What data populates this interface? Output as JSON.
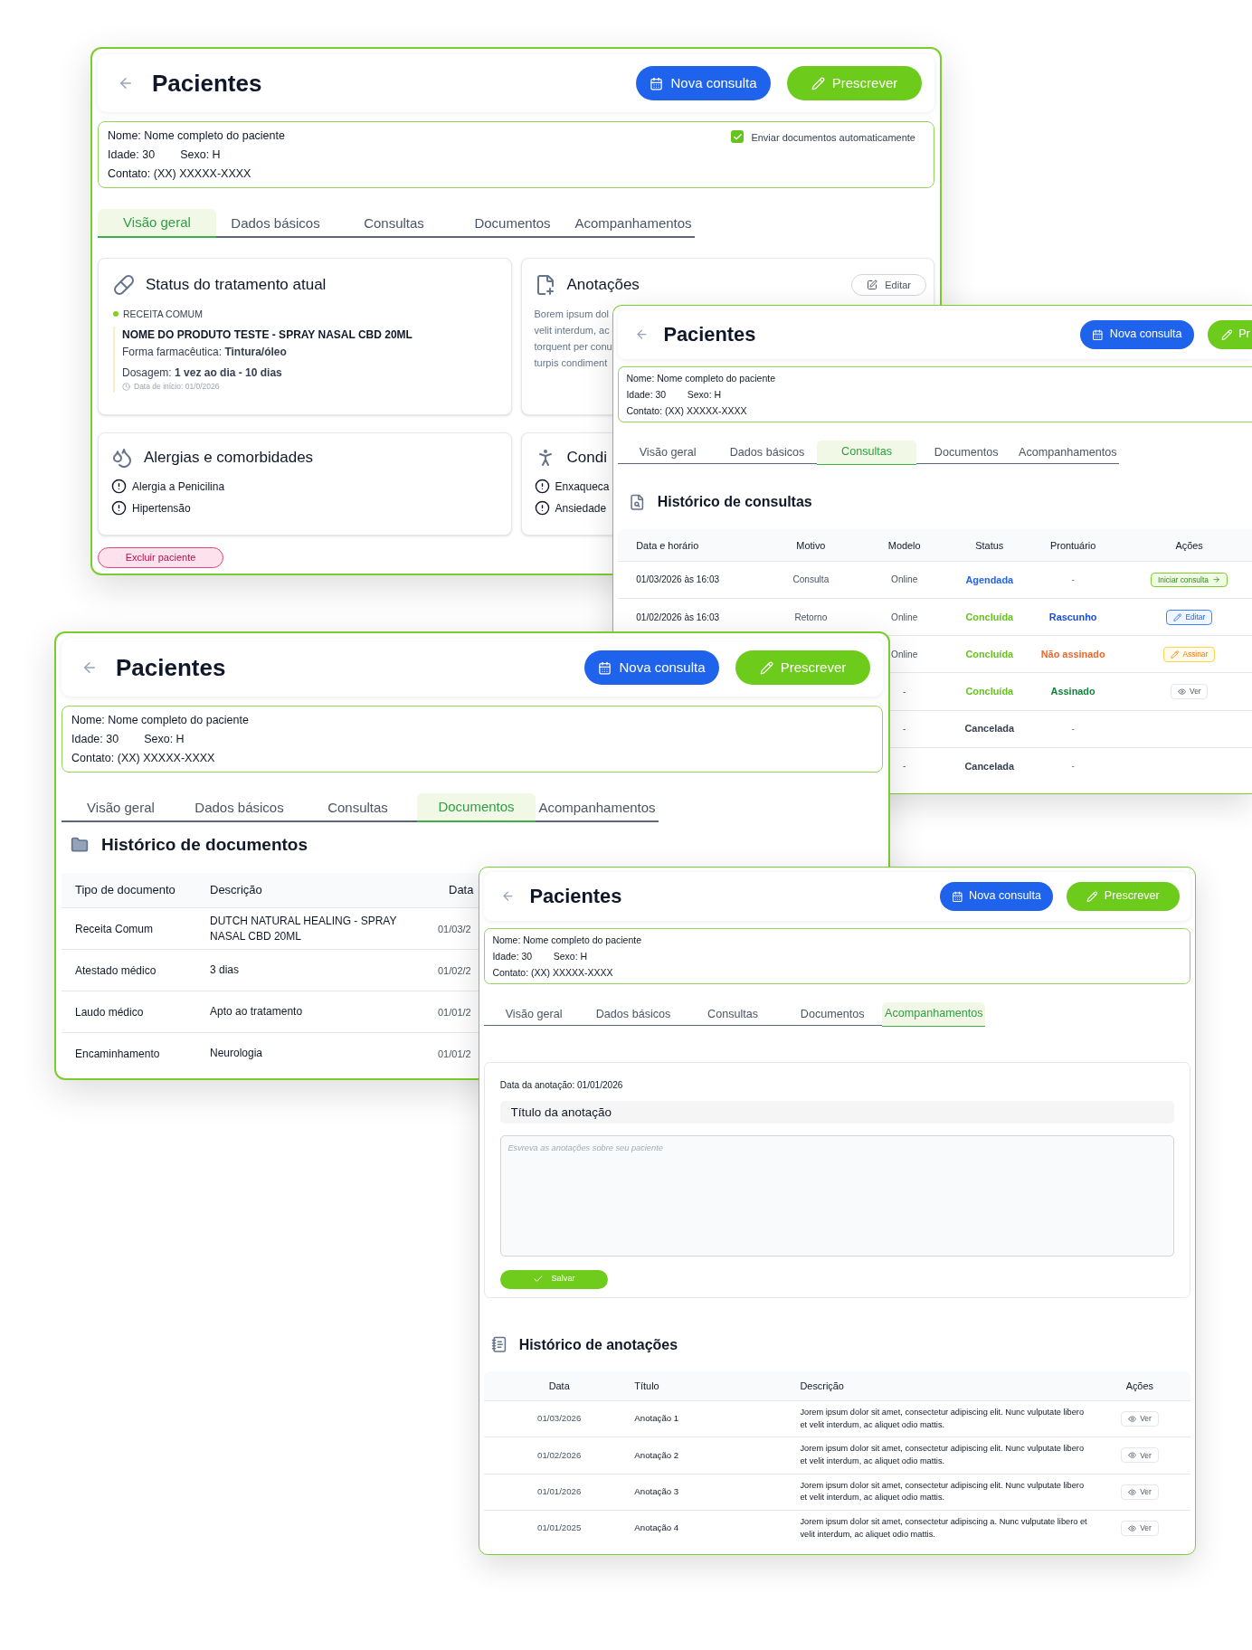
{
  "windows": [
    {
      "kind": "overview",
      "title": "Pacientes",
      "buttons": [
        {
          "kind": "primary",
          "label": "Nova consulta"
        },
        {
          "kind": "secondary",
          "label": "Prescrever"
        }
      ],
      "patient": {
        "name": "Nome: Nome completo do paciente",
        "age": "Idade: 30",
        "sex": "Sexo: H",
        "contact": "Contato: (XX) XXXXX-XXXX"
      },
      "auto_send": {
        "label": "Enviar documentos automaticamente",
        "checked": true
      },
      "tabs": [
        {
          "label": "Visão geral",
          "selected": true
        },
        {
          "label": "Dados básicos",
          "selected": false
        },
        {
          "label": "Consultas",
          "selected": false
        },
        {
          "label": "Documentos",
          "selected": false
        },
        {
          "label": "Acompanhamentos",
          "selected": false
        }
      ],
      "treatment_card": {
        "title": "Status do tratamento atual",
        "badge": "RECEITA COMUM",
        "product": "NOME DO PRODUTO TESTE - SPRAY NASAL CBD 20ML",
        "form": "Forma farmacêutica: **Tintura/óleo**",
        "dosage": "Dosagem: **1 vez ao dia - 10 dias**",
        "start_date": "Data de início: 01/0/2026"
      },
      "notes_card": {
        "title": "Anotações",
        "edit_button": "Editar",
        "lines": [
          "Borem ipsum dol",
          "velit interdum, ac",
          "torquent per conu",
          "turpis condiment"
        ]
      },
      "allergies_card": {
        "title": "Alergias e comorbidades",
        "items": [
          "Alergia a Penicilina",
          "Hipertensão"
        ]
      },
      "conditions_card": {
        "title": "Condi",
        "items": [
          "Enxaqueca",
          "Ansiedade"
        ]
      },
      "delete_button": "Excluir paciente"
    },
    {
      "kind": "consultations",
      "title": "Pacientes",
      "buttons": [
        {
          "kind": "primary",
          "label": "Nova consulta"
        },
        {
          "kind": "secondary",
          "label": "Pr"
        }
      ],
      "patient": {
        "name": "Nome: Nome completo do paciente",
        "age": "Idade: 30",
        "sex": "Sexo: H",
        "contact": "Contato: (XX) XXXXX-XXXX"
      },
      "tabs": [
        {
          "label": "Visão geral",
          "selected": false
        },
        {
          "label": "Dados básicos",
          "selected": false
        },
        {
          "label": "Consultas",
          "selected": true
        },
        {
          "label": "Documentos",
          "selected": false
        },
        {
          "label": "Acompanhamentos",
          "selected": false
        }
      ],
      "section_title": "Histórico de consultas",
      "columns": [
        "Data e horário",
        "Motivo",
        "Modelo",
        "Status",
        "Prontuário",
        "Ações"
      ],
      "rows": [
        {
          "date": "01/03/2026 às 16:03",
          "reason": "Consulta",
          "model": "Online",
          "status": {
            "text": "Agendada",
            "color": "#2563eb"
          },
          "record": {
            "text": "-"
          },
          "action": {
            "kind": "start",
            "label": "Iniciar consulta"
          }
        },
        {
          "date": "01/02/2026 às 16:03",
          "reason": "Retorno",
          "model": "Online",
          "status": {
            "text": "Concluída",
            "color": "#65c31d"
          },
          "record": {
            "text": "Rascunho",
            "color": "#1d4ed8"
          },
          "action": {
            "kind": "edit",
            "label": "Editar"
          }
        },
        {
          "model": "Online",
          "status": {
            "text": "Concluída",
            "color": "#65c31d"
          },
          "record": {
            "text": "Não assinado",
            "color": "#f26522"
          },
          "action": {
            "kind": "sign",
            "label": "Assinar"
          }
        },
        {
          "model": "-",
          "status": {
            "text": "Concluída",
            "color": "#65c31d"
          },
          "record": {
            "text": "Assinado",
            "color": "#15803d"
          },
          "action": {
            "kind": "view",
            "label": "Ver"
          }
        },
        {
          "model": "-",
          "status": {
            "text": "Cancelada",
            "color": "#374151"
          },
          "record": {
            "text": "-"
          }
        },
        {
          "model": "-",
          "status": {
            "text": "Cancelada",
            "color": "#374151"
          },
          "record": {
            "text": "-"
          }
        }
      ]
    },
    {
      "kind": "documents",
      "title": "Pacientes",
      "buttons": [
        {
          "kind": "primary",
          "label": "Nova consulta"
        },
        {
          "kind": "secondary",
          "label": "Prescrever"
        }
      ],
      "patient": {
        "name": "Nome: Nome completo do paciente",
        "age": "Idade: 30",
        "sex": "Sexo: H",
        "contact": "Contato: (XX) XXXXX-XXXX"
      },
      "tabs": [
        {
          "label": "Visão geral",
          "selected": false
        },
        {
          "label": "Dados básicos",
          "selected": false
        },
        {
          "label": "Consultas",
          "selected": false
        },
        {
          "label": "Documentos",
          "selected": true
        },
        {
          "label": "Acompanhamentos",
          "selected": false
        }
      ],
      "section_title": "Histórico de documentos",
      "columns": [
        "Tipo de documento",
        "Descrição",
        "Data"
      ],
      "rows": [
        {
          "type": "Receita Comum",
          "description": "DUTCH NATURAL HEALING - SPRAY NASAL CBD 20ML",
          "date": "01/03/2"
        },
        {
          "type": "Atestado médico",
          "description": "3 dias",
          "date": "01/02/2"
        },
        {
          "type": "Laudo médico",
          "description": "Apto ao tratamento",
          "date": "01/01/2"
        },
        {
          "type": "Encaminhamento",
          "description": "Neurologia",
          "date": "01/01/2"
        }
      ]
    },
    {
      "kind": "follow_up",
      "title": "Pacientes",
      "buttons": [
        {
          "kind": "primary",
          "label": "Nova consulta"
        },
        {
          "kind": "secondary",
          "label": "Prescrever"
        }
      ],
      "patient": {
        "name": "Nome: Nome completo do paciente",
        "age": "Idade: 30",
        "sex": "Sexo: H",
        "contact": "Contato: (XX) XXXXX-XXXX"
      },
      "tabs": [
        {
          "label": "Visão geral",
          "selected": false
        },
        {
          "label": "Dados básicos",
          "selected": false
        },
        {
          "label": "Consultas",
          "selected": false
        },
        {
          "label": "Documentos",
          "selected": false
        },
        {
          "label": "Acompanhamentos",
          "selected": true
        }
      ],
      "date_label": "Data da anotação: 01/01/2026",
      "title_field": {
        "value": "Título da anotação"
      },
      "notes_field": {
        "placeholder": "Esvreva as anotações sobre seu paciente"
      },
      "save_button": "Salvar",
      "section_title": "Histórico de anotações",
      "columns": [
        "Data",
        "Título",
        "Descrição",
        "Ações"
      ],
      "rows": [
        {
          "date": "01/03/2026",
          "title": "Anotação 1",
          "description": "Jorem ipsum dolor sit amet, consectetur adipiscing elit. Nunc vulputate libero et velit interdum, ac aliquet odio mattis.",
          "action": "Ver"
        },
        {
          "date": "01/02/2026",
          "title": "Anotação 2",
          "description": "Jorem ipsum dolor sit amet, consectetur adipiscing elit. Nunc vulputate libero et velit interdum, ac aliquet odio mattis.",
          "action": "Ver"
        },
        {
          "date": "01/01/2026",
          "title": "Anotação 3",
          "description": "Jorem ipsum dolor sit amet, consectetur adipiscing elit. Nunc vulputate libero et velit interdum, ac aliquet odio mattis.",
          "action": "Ver"
        },
        {
          "date": "01/01/2025",
          "title": "Anotação 4",
          "description": "Jorem ipsum dolor sit amet, consectetur adipiscing a. Nunc vulputate libero et velit interdum, ac aliquet odio mattis.",
          "action": "Ver"
        }
      ]
    }
  ]
}
